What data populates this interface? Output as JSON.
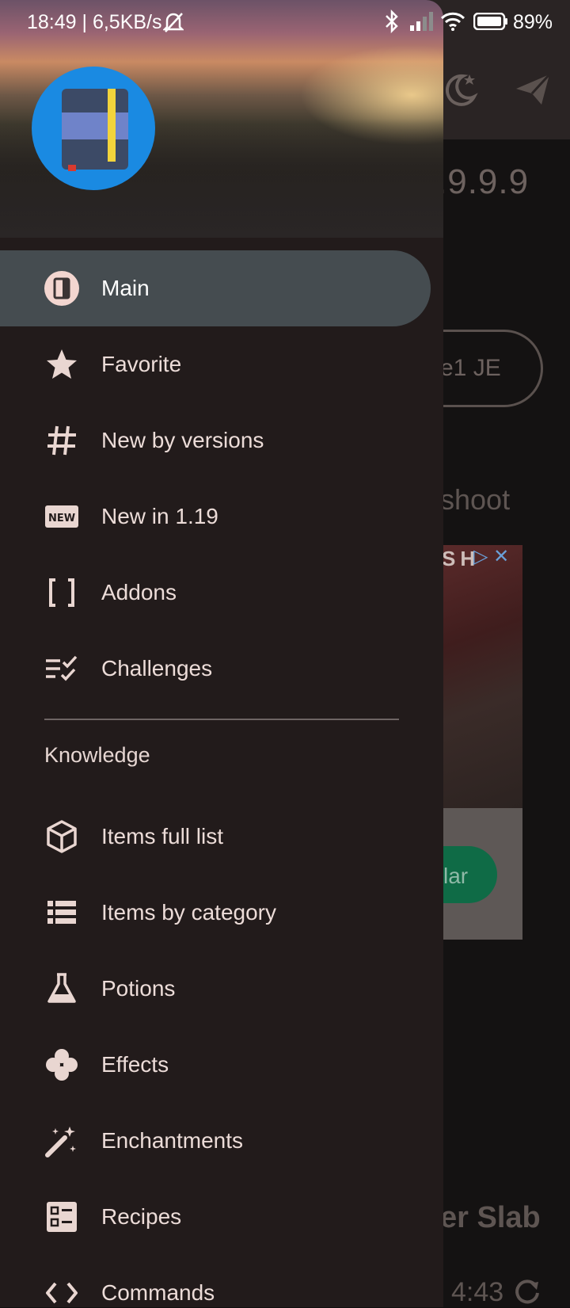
{
  "status_bar": {
    "time_speed": "18:49 | 6,5KB/s",
    "battery": "89%"
  },
  "background": {
    "version_fragment": ".9.9.9",
    "pill_fragment": "e1 JE",
    "heading_fragment": "shoot",
    "ad_label_fragment": "SH",
    "ad_button_fragment": "lar",
    "slab_fragment": "er Slab",
    "duration": "4:43"
  },
  "drawer": {
    "items": [
      {
        "label": "Main",
        "icon": "book-icon",
        "active": true
      },
      {
        "label": "Favorite",
        "icon": "star-icon"
      },
      {
        "label": "New by versions",
        "icon": "hash-icon"
      },
      {
        "label": "New in 1.19",
        "icon": "new-badge-icon"
      },
      {
        "label": "Addons",
        "icon": "brackets-icon"
      },
      {
        "label": "Challenges",
        "icon": "checklist-icon"
      }
    ],
    "section_title": "Knowledge",
    "knowledge_items": [
      {
        "label": "Items full list",
        "icon": "cube-icon"
      },
      {
        "label": "Items by category",
        "icon": "list-icon"
      },
      {
        "label": "Potions",
        "icon": "flask-icon"
      },
      {
        "label": "Effects",
        "icon": "clover-icon"
      },
      {
        "label": "Enchantments",
        "icon": "magic-wand-icon"
      },
      {
        "label": "Recipes",
        "icon": "recipe-icon"
      },
      {
        "label": "Commands",
        "icon": "code-icon"
      }
    ]
  },
  "colors": {
    "drawer_bg": "#221b1b",
    "active_item_bg": "#454c50",
    "logo_bg": "#1a8ae2",
    "ad_button": "#0f6b46"
  }
}
